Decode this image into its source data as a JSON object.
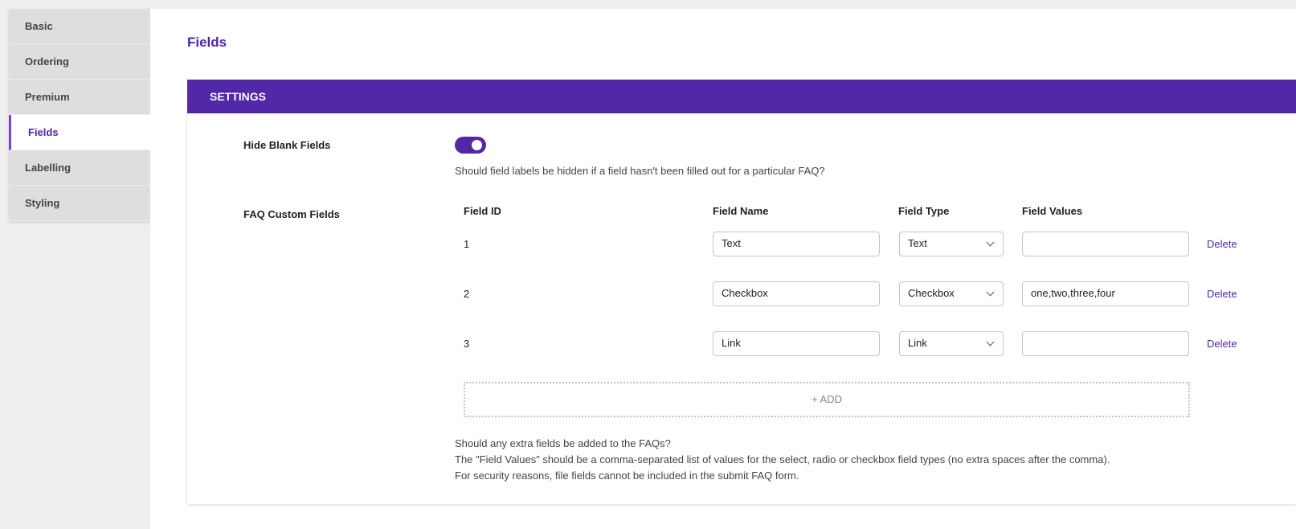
{
  "sidebar": {
    "items": [
      {
        "label": "Basic"
      },
      {
        "label": "Ordering"
      },
      {
        "label": "Premium"
      },
      {
        "label": "Fields",
        "active": true
      },
      {
        "label": "Labelling"
      },
      {
        "label": "Styling"
      }
    ]
  },
  "page_title": "Fields",
  "section_title": "SETTINGS",
  "hide_blank": {
    "label": "Hide Blank Fields",
    "enabled": true,
    "description": "Should field labels be hidden if a field hasn't been filled out for a particular FAQ?"
  },
  "custom_fields": {
    "label": "FAQ Custom Fields",
    "headers": [
      "Field ID",
      "Field Name",
      "Field Type",
      "Field Values"
    ],
    "rows": [
      {
        "id": "1",
        "name": "Text",
        "type": "Text",
        "values": "",
        "delete": "Delete"
      },
      {
        "id": "2",
        "name": "Checkbox",
        "type": "Checkbox",
        "values": "one,two,three,four",
        "delete": "Delete"
      },
      {
        "id": "3",
        "name": "Link",
        "type": "Link",
        "values": "",
        "delete": "Delete"
      }
    ],
    "add_label": "+ ADD",
    "description": [
      "Should any extra fields be added to the FAQs?",
      "The \"Field Values\" should be a comma-separated list of values for the select, radio or checkbox field types (no extra spaces after the comma).",
      "For security reasons, file fields cannot be included in the submit FAQ form."
    ]
  },
  "colors": {
    "accent": "#5227a8"
  }
}
